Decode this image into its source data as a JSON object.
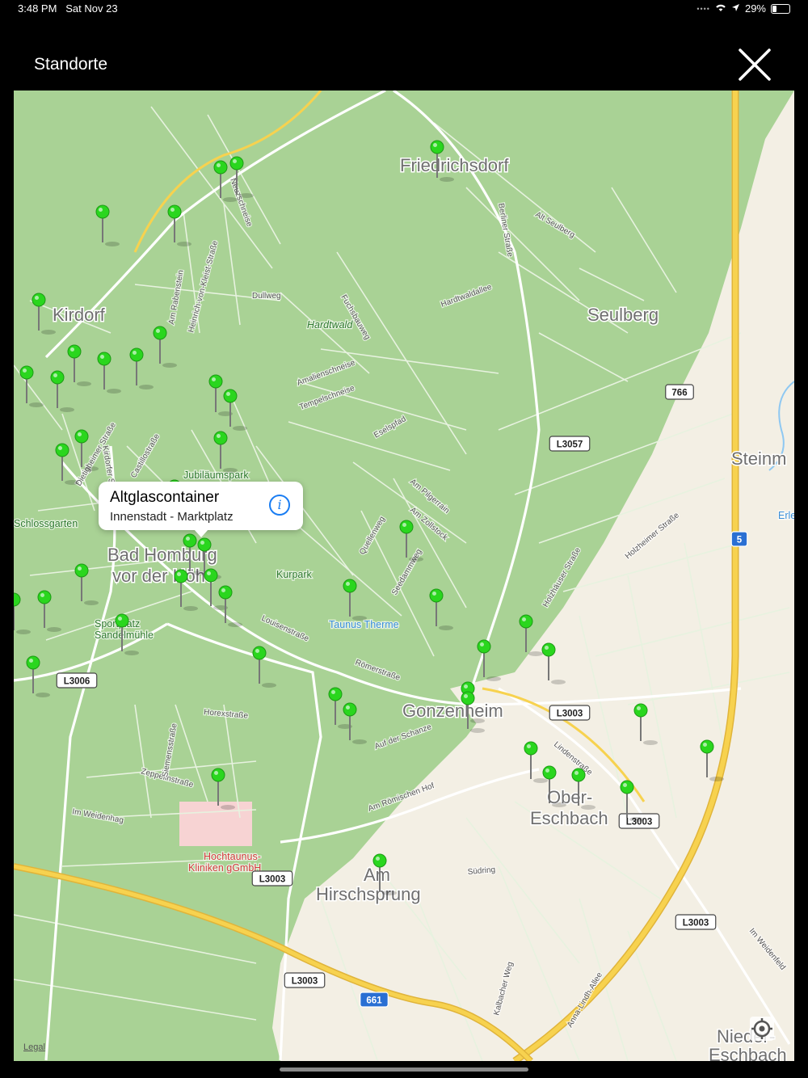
{
  "status_bar": {
    "time": "3:48 PM",
    "date": "Sat Nov 23",
    "battery": "29%"
  },
  "header": {
    "title": "Standorte"
  },
  "callout": {
    "title": "Altglascontainer",
    "subtitle": "Innenstadt - Marktplatz",
    "info_icon": "info-icon"
  },
  "map": {
    "legal": "Legal",
    "colors": {
      "park": "#a9d295",
      "urban": "#f3efe4",
      "road": "#ffffff",
      "highway": "#f5c84b",
      "pin": "#2ad61e"
    },
    "places": [
      {
        "name": "Friedrichsdorf"
      },
      {
        "name": "Kirdorf"
      },
      {
        "name": "Seulberg"
      },
      {
        "name": "Steinm"
      },
      {
        "name": "Bad Homburg"
      },
      {
        "name": "vor der Höhe"
      },
      {
        "name": "Gonzenheim"
      },
      {
        "name": "Ober-"
      },
      {
        "name": "Eschbach"
      },
      {
        "name": "Am"
      },
      {
        "name": "Hirschsprung"
      },
      {
        "name": "Nieder-"
      },
      {
        "name": "Eschbach"
      }
    ],
    "road_labels": [
      {
        "name": "Dullweg"
      },
      {
        "name": "Hardtwald"
      },
      {
        "name": "Fuchsbauweg"
      },
      {
        "name": "Alt Seulberg"
      },
      {
        "name": "Hardtwaldallee"
      },
      {
        "name": "Berliner Straße"
      },
      {
        "name": "Tempelschneise"
      },
      {
        "name": "Amalienschneise"
      },
      {
        "name": "Eselspfad"
      },
      {
        "name": "Am Pilgerrain"
      },
      {
        "name": "Am Zollstock"
      },
      {
        "name": "Quellenweg"
      },
      {
        "name": "Seedammweg"
      },
      {
        "name": "Louisenstraße"
      },
      {
        "name": "Römerstraße"
      },
      {
        "name": "Auf der Schanze"
      },
      {
        "name": "Am Römischen Hof"
      },
      {
        "name": "Südring"
      },
      {
        "name": "Horexstraße"
      },
      {
        "name": "Zeppelinstraße"
      },
      {
        "name": "Siemensstraße"
      },
      {
        "name": "Im Weidenhag"
      },
      {
        "name": "Kalbacher Weg"
      },
      {
        "name": "Anna-Lindh-Allee"
      },
      {
        "name": "Holzhäuser Straße"
      },
      {
        "name": "Holzheimer Straße"
      },
      {
        "name": "Kirdorfer Straße"
      },
      {
        "name": "Dietigheimer Straße"
      },
      {
        "name": "Castillostraße"
      },
      {
        "name": "Jubiläumspark"
      },
      {
        "name": "Kurpark"
      },
      {
        "name": "Taunus Therme"
      },
      {
        "name": "Sportplatz"
      },
      {
        "name": "Sandelmühle"
      },
      {
        "name": "Schlossgarten"
      },
      {
        "name": "Hochtaunus-"
      },
      {
        "name": "Kliniken gGmbH"
      },
      {
        "name": "Neuzschneise"
      },
      {
        "name": "Am Rabenstein"
      },
      {
        "name": "Heinrich-von-Kleist-Straße"
      },
      {
        "name": "Erle"
      },
      {
        "name": "Lindenstraße"
      },
      {
        "name": "Im Weidenfeld"
      }
    ],
    "shields": [
      {
        "label": "766"
      },
      {
        "label": "L3057"
      },
      {
        "label": "5"
      },
      {
        "label": "L3006"
      },
      {
        "label": "L3003"
      },
      {
        "label": "L3003"
      },
      {
        "label": "L3003"
      },
      {
        "label": "L3003"
      },
      {
        "label": "L3003"
      },
      {
        "label": "661"
      }
    ],
    "pin_count": 54
  }
}
